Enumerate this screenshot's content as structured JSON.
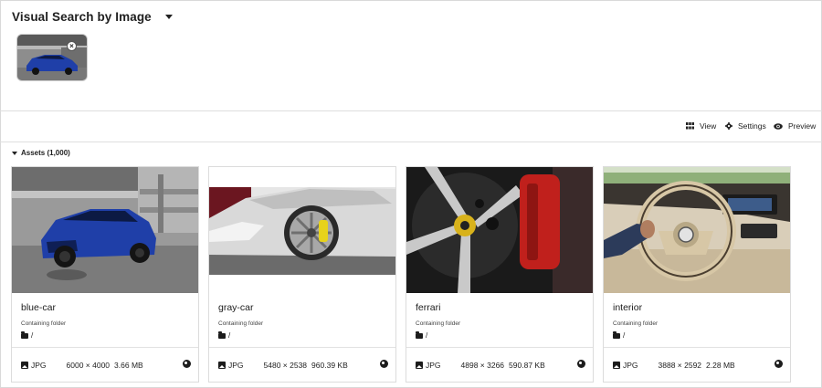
{
  "header": {
    "title": "Visual Search by Image",
    "query_image_icon": "close-circle-icon"
  },
  "toolbar": {
    "view_label": "View",
    "settings_label": "Settings",
    "preview_label": "Preview"
  },
  "assets": {
    "label": "Assets (1,000)",
    "cards": [
      {
        "name": "blue-car",
        "folder_label": "Containing folder",
        "folder_path": "/",
        "type": "JPG",
        "dimensions": "6000 × 4000",
        "size": "3.66 MB"
      },
      {
        "name": "gray-car",
        "folder_label": "Containing folder",
        "folder_path": "/",
        "type": "JPG",
        "dimensions": "5480 × 2538",
        "size": "960.39 KB"
      },
      {
        "name": "ferrari",
        "folder_label": "Containing folder",
        "folder_path": "/",
        "type": "JPG",
        "dimensions": "4898 × 3266",
        "size": "590.87 KB"
      },
      {
        "name": "interior",
        "folder_label": "Containing folder",
        "folder_path": "/",
        "type": "JPG",
        "dimensions": "3888 × 2592",
        "size": "2.28 MB"
      }
    ]
  },
  "colors": {
    "accent_blue_car": "#1f3fa8",
    "ferrari_caliper": "#c0201c",
    "border": "#dcdcdc"
  }
}
